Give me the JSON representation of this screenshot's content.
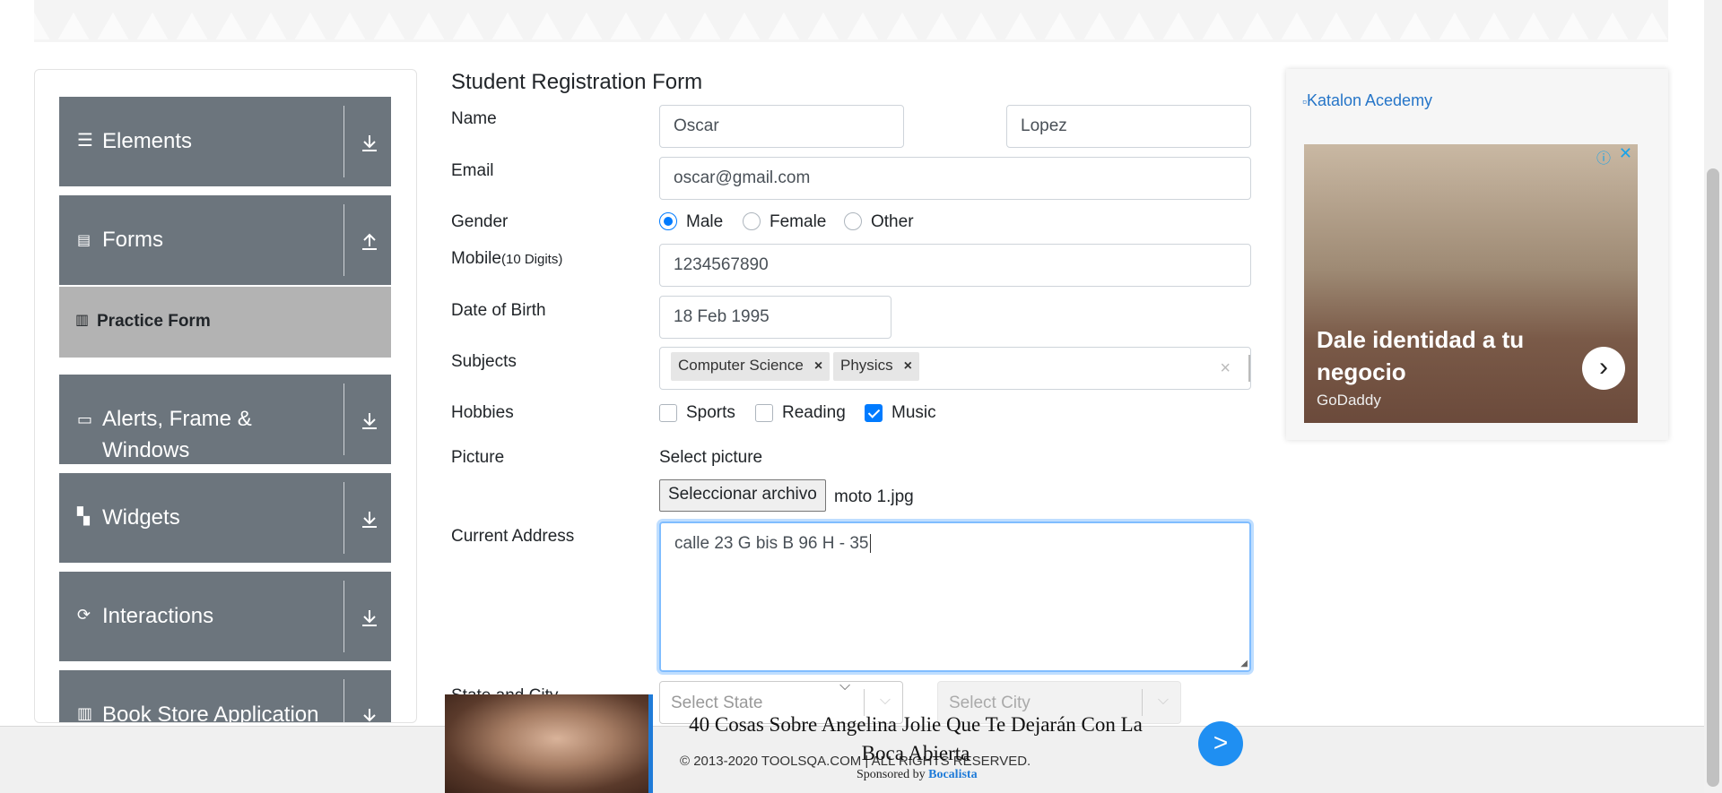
{
  "sidebar": {
    "groups": [
      {
        "label": "Elements",
        "icon": "list-icon",
        "arrow": "down"
      },
      {
        "label": "Forms",
        "icon": "document-icon",
        "arrow": "up"
      },
      {
        "label": "Alerts, Frame &",
        "label2": "Windows",
        "icon": "window-icon",
        "arrow": "down"
      },
      {
        "label": "Widgets",
        "icon": "widgets-icon",
        "arrow": "down"
      },
      {
        "label": "Interactions",
        "icon": "interactions-icon",
        "arrow": "down"
      },
      {
        "label": "Book Store Application",
        "icon": "books-icon",
        "arrow": "down"
      }
    ],
    "active_item": "Practice Form"
  },
  "form": {
    "title": "Student Registration Form",
    "name_label": "Name",
    "first_name": "Oscar",
    "last_name": "Lopez",
    "email_label": "Email",
    "email": "oscar@gmail.com",
    "gender_label": "Gender",
    "genders": [
      "Male",
      "Female",
      "Other"
    ],
    "gender_selected": "Male",
    "mobile_label": "Mobile",
    "mobile_hint": "(10 Digits)",
    "mobile": "1234567890",
    "dob_label": "Date of Birth",
    "dob": "18 Feb 1995",
    "subjects_label": "Subjects",
    "subjects": [
      "Computer Science",
      "Physics"
    ],
    "hobbies_label": "Hobbies",
    "hobbies": [
      {
        "label": "Sports",
        "checked": false
      },
      {
        "label": "Reading",
        "checked": false
      },
      {
        "label": "Music",
        "checked": true
      }
    ],
    "picture_label": "Picture",
    "picture_prompt": "Select picture",
    "file_button": "Seleccionar archivo",
    "file_name": "moto 1.jpg",
    "address_label": "Current Address",
    "address": "calle 23 G bis B 96 H - 35",
    "state_city_label": "State and City",
    "state_placeholder": "Select State",
    "city_placeholder": "Select City"
  },
  "ad": {
    "link_text": "Katalon Acedemy",
    "headline": "Dale identidad a tu negocio",
    "brand": "GoDaddy"
  },
  "footer": {
    "copyright": "© 2013-2020 TOOLSQA.COM | ALL RIGHTS RESERVED."
  },
  "popup": {
    "title": "40 Cosas Sobre Angelina Jolie Que Te Dejarán Con La Boca Abierta",
    "sponsored_prefix": "Sponsored by",
    "sponsor": "Bocalista"
  },
  "colors": {
    "accent": "#007bff",
    "sidebar_group": "#6c757d",
    "active_item": "#b3b3b3"
  }
}
